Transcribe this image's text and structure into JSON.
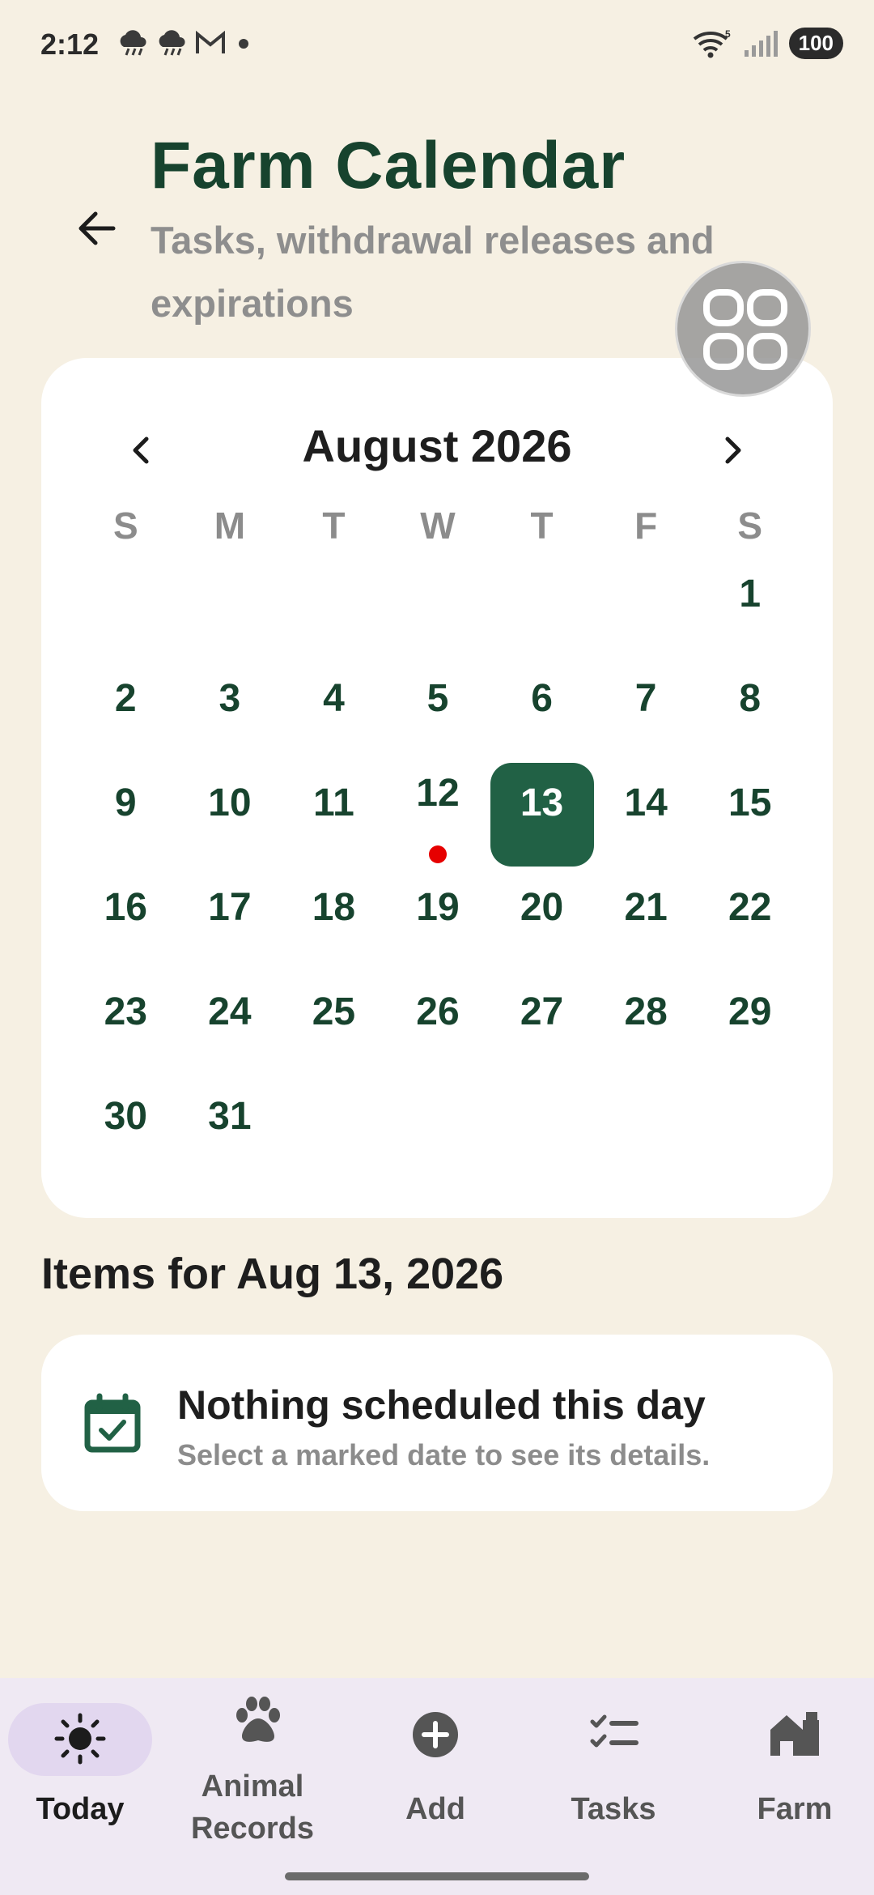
{
  "status_bar": {
    "time": "2:12",
    "battery": "100",
    "wifi_label": "5",
    "icons": [
      "storm-cloud-icon",
      "storm-cloud-icon",
      "gmail-icon",
      "dot-icon"
    ]
  },
  "header": {
    "title": "Farm Calendar",
    "subtitle": "Tasks, withdrawal releases and expirations"
  },
  "calendar": {
    "month_label": "August 2026",
    "weekdays": [
      "S",
      "M",
      "T",
      "W",
      "T",
      "F",
      "S"
    ],
    "leading_blanks": 6,
    "days": [
      "1",
      "2",
      "3",
      "4",
      "5",
      "6",
      "7",
      "8",
      "9",
      "10",
      "11",
      "12",
      "13",
      "14",
      "15",
      "16",
      "17",
      "18",
      "19",
      "20",
      "21",
      "22",
      "23",
      "24",
      "25",
      "26",
      "27",
      "28",
      "29",
      "30",
      "31"
    ],
    "selected_day": "13",
    "marked_days": [
      "12"
    ],
    "colors": {
      "selected": "#216145",
      "marker": "#e60000",
      "day_text": "#17432e"
    }
  },
  "items": {
    "heading": "Items for Aug 13, 2026",
    "empty_title": "Nothing scheduled this day",
    "empty_subtitle": "Select a marked date to see its details."
  },
  "nav": {
    "today": "Today",
    "animal_records_1": "Animal",
    "animal_records_2": "Records",
    "add": "Add",
    "tasks": "Tasks",
    "farm": "Farm"
  }
}
